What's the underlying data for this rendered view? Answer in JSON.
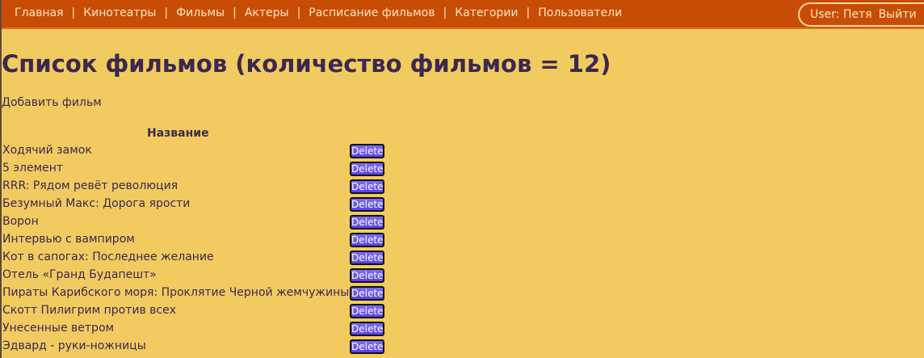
{
  "nav": {
    "items": [
      {
        "label": "Главная"
      },
      {
        "label": "Кинотеатры"
      },
      {
        "label": "Фильмы"
      },
      {
        "label": "Актеры"
      },
      {
        "label": "Расписание фильмов"
      },
      {
        "label": "Категории"
      },
      {
        "label": "Пользователи"
      }
    ],
    "separator": "|"
  },
  "user": {
    "label": "User: Петя",
    "logout": "Выйти"
  },
  "page": {
    "title": "Список фильмов (количество фильмов = 12)",
    "add_link": "Добавить фильм",
    "column_header": "Название",
    "delete_label": "Delete"
  },
  "films": [
    "Ходячий замок",
    "5 элемент",
    "RRR: Рядом ревёт революция",
    "Безумный Макс: Дорога ярости",
    "Ворон",
    "Интервью с вампиром",
    "Кот в сапогах: Последнее желание",
    "Отель «Гранд Будапешт»",
    "Пираты Карибского моря: Проклятие Черной жемчужины",
    "Скотт Пилигрим против всех",
    "Унесенные ветром",
    "Эдвард - руки-ножницы"
  ],
  "colors": {
    "background": "#f1cb60",
    "navbar": "#c94c05",
    "text": "#3b2850",
    "button": "#6a58ee"
  }
}
